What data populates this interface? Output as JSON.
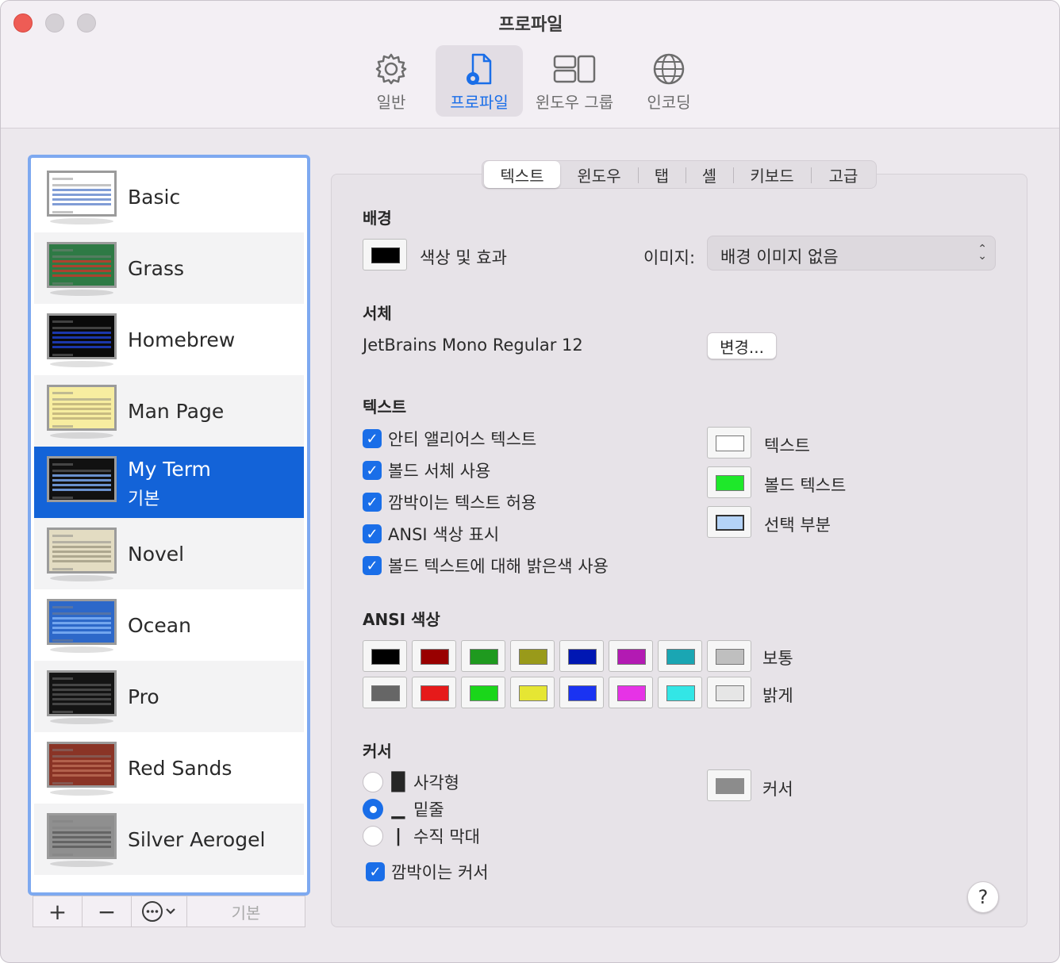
{
  "window": {
    "title": "프로파일"
  },
  "toolbar": {
    "items": [
      {
        "label": "일반",
        "icon": "gear-icon"
      },
      {
        "label": "프로파일",
        "icon": "profile-doc-icon",
        "active": true
      },
      {
        "label": "윈도우 그룹",
        "icon": "window-group-icon"
      },
      {
        "label": "인코딩",
        "icon": "globe-icon"
      }
    ]
  },
  "profiles": {
    "items": [
      {
        "name": "Basic",
        "thumb_bg": "#ffffff",
        "thumb_fg": "#6a8ccf"
      },
      {
        "name": "Grass",
        "thumb_bg": "#2e7a45",
        "thumb_fg": "#c0392b"
      },
      {
        "name": "Homebrew",
        "thumb_bg": "#0a0a0a",
        "thumb_fg": "#1e40c8"
      },
      {
        "name": "Man Page",
        "thumb_bg": "#f7eda0",
        "thumb_fg": "#bfb27a"
      },
      {
        "name": "My Term",
        "subtitle": "기본",
        "thumb_bg": "#111111",
        "thumb_fg": "#7aa8ee",
        "selected": true
      },
      {
        "name": "Novel",
        "thumb_bg": "#e3dcc2",
        "thumb_fg": "#a39e86"
      },
      {
        "name": "Ocean",
        "thumb_bg": "#2d68c9",
        "thumb_fg": "#7fb0f5"
      },
      {
        "name": "Pro",
        "thumb_bg": "#141414",
        "thumb_fg": "#4d4d4d"
      },
      {
        "name": "Red Sands",
        "thumb_bg": "#8a3426",
        "thumb_fg": "#b86a53"
      },
      {
        "name": "Silver Aerogel",
        "thumb_bg": "#8f8f8f",
        "thumb_fg": "#5d5d5d"
      }
    ],
    "buttons": {
      "add": "+",
      "remove": "−",
      "default": "기본"
    }
  },
  "tabs": [
    "텍스트",
    "윈도우",
    "탭",
    "셸",
    "키보드",
    "고급"
  ],
  "background": {
    "heading": "배경",
    "color_label": "색상 및 효과",
    "image_label": "이미지:",
    "image_value": "배경 이미지 없음"
  },
  "font": {
    "heading": "서체",
    "value": "JetBrains Mono Regular 12",
    "change_button": "변경..."
  },
  "text": {
    "heading": "텍스트",
    "options": [
      {
        "label": "안티 앨리어스 텍스트",
        "checked": true
      },
      {
        "label": "볼드 서체 사용",
        "checked": true
      },
      {
        "label": "깜박이는 텍스트 허용",
        "checked": true
      },
      {
        "label": "ANSI 색상 표시",
        "checked": true
      },
      {
        "label": "볼드 텍스트에 대해 밝은색 사용",
        "checked": true
      }
    ],
    "colors": [
      {
        "label": "텍스트",
        "color": "#ffffff"
      },
      {
        "label": "볼드 텍스트",
        "color": "#1ee82a"
      },
      {
        "label": "선택 부분",
        "color": "#b4d3f7"
      }
    ]
  },
  "ansi": {
    "heading": "ANSI 색상",
    "normal_label": "보통",
    "bright_label": "밝게",
    "normal": [
      "#000000",
      "#990000",
      "#1f9a1f",
      "#999a1a",
      "#0017b3",
      "#b31ab3",
      "#1aa6b3",
      "#bfbfbf"
    ],
    "bright": [
      "#666666",
      "#e61a1a",
      "#1ad61a",
      "#e6e633",
      "#1a33f2",
      "#e633e6",
      "#33e6e6",
      "#e6e6e6"
    ]
  },
  "cursor": {
    "heading": "커서",
    "styles": [
      {
        "glyph": "█",
        "label": "사각형",
        "selected": false
      },
      {
        "glyph": "▁",
        "label": "밑줄",
        "selected": true
      },
      {
        "glyph": "|",
        "label": "수직 막대",
        "selected": false
      }
    ],
    "blink_label": "깜박이는 커서",
    "blink_checked": true,
    "color_label": "커서",
    "color": "#8c8c8c"
  },
  "help": "?"
}
